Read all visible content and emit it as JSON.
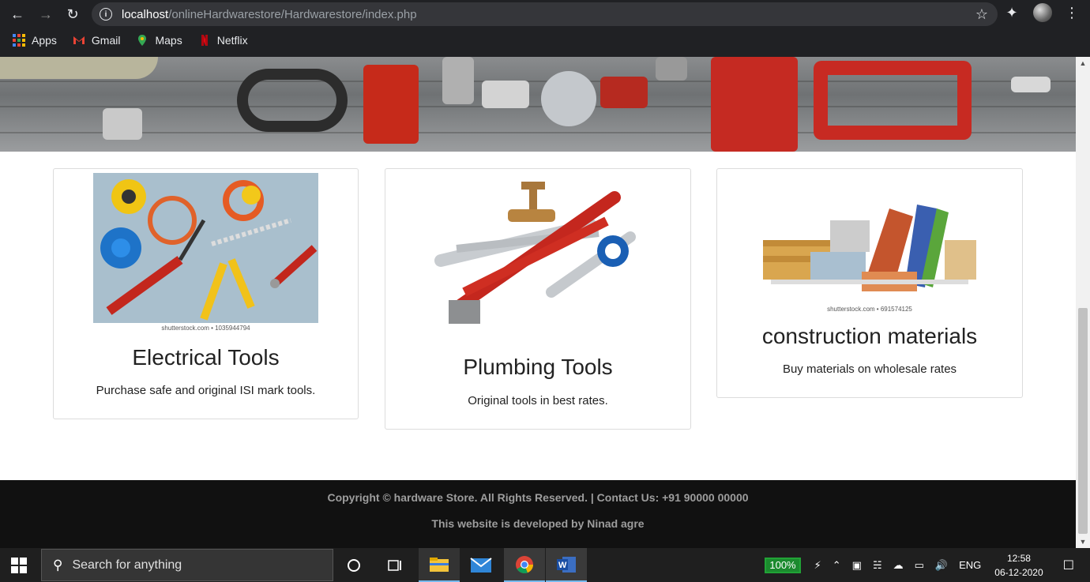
{
  "browser": {
    "url_host": "localhost",
    "url_path": "/onlineHardwarestore/Hardwarestore/index.php",
    "bookmarks": [
      {
        "label": "Apps",
        "icon": "apps-grid-icon"
      },
      {
        "label": "Gmail",
        "icon": "gmail-icon"
      },
      {
        "label": "Maps",
        "icon": "maps-pin-icon"
      },
      {
        "label": "Netflix",
        "icon": "netflix-icon"
      }
    ]
  },
  "cards": [
    {
      "title": "Electrical Tools",
      "description": "Purchase safe and original ISI mark tools.",
      "watermark": "shutterstock.com • 1035944794"
    },
    {
      "title": "Plumbing Tools",
      "description": "Original tools in best rates.",
      "watermark": ""
    },
    {
      "title": "construction materials",
      "description": "Buy materials on wholesale rates",
      "watermark": "shutterstock.com • 691574125"
    }
  ],
  "footer": {
    "copyright": "Copyright © hardware Store. All Rights Reserved. | Contact Us: +91 90000 00000",
    "developer": "This website is developed by Ninad agre"
  },
  "taskbar": {
    "search_placeholder": "Search for anything",
    "battery": "100%",
    "language": "ENG",
    "time": "12:58",
    "date": "06-12-2020"
  },
  "colors": {
    "footer_bg": "#111111",
    "footer_text": "#9d9d9d",
    "battery_green": "#1b8a2e"
  }
}
